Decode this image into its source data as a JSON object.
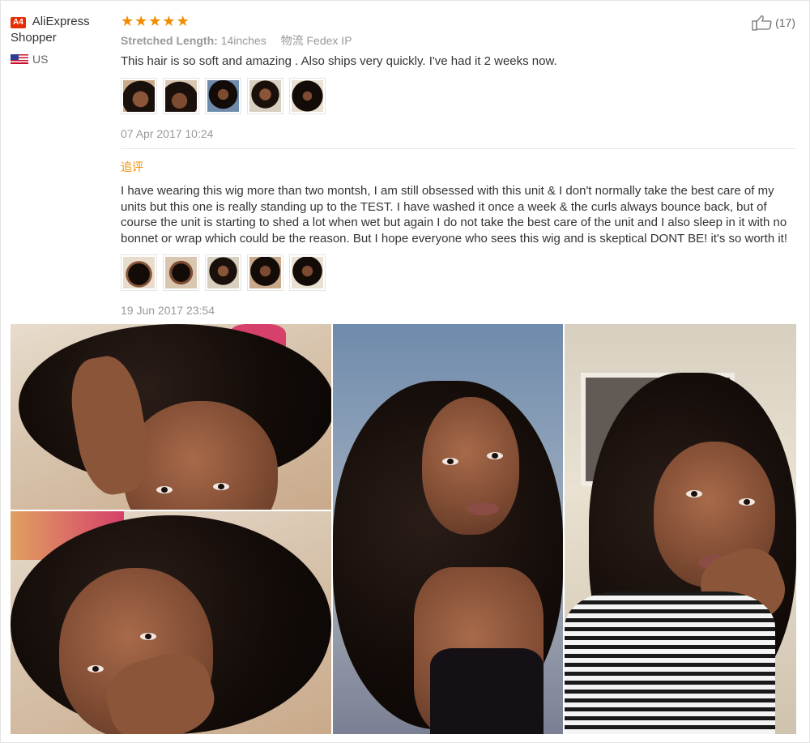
{
  "user": {
    "badge": "A4",
    "name_line1": "AliExpress",
    "name_line2": "Shopper",
    "country": "US",
    "flag_icon": "us-flag-icon"
  },
  "rating": {
    "stars": 5,
    "star_color": "#f28c00"
  },
  "helpful": {
    "count_text": "(17)",
    "icon": "thumbs-up-icon"
  },
  "review": {
    "meta_label": "Stretched Length:",
    "meta_value": "14inches",
    "shipping": "物流 Fedex IP",
    "text": "This hair is so soft and amazing . Also ships very quickly. I've had it 2 weeks now.",
    "date": "07 Apr 2017 10:24"
  },
  "followup": {
    "label": "追评",
    "label_color": "#f28c00",
    "text": "I have wearing this wig more than two montsh, I am still obsessed with this unit & I don't normally take the best care of my units but this one is really standing up to the TEST. I have washed it once a week & the curls always bounce back, but of course the unit is starting to shed a lot when wet but again I do not take the best care of the unit and I also sleep in it with no bonnet or wrap which could be the reason. But I hope everyone who sees this wig and is skeptical DONT BE! it's so worth it!",
    "date": "19 Jun 2017 23:54"
  }
}
